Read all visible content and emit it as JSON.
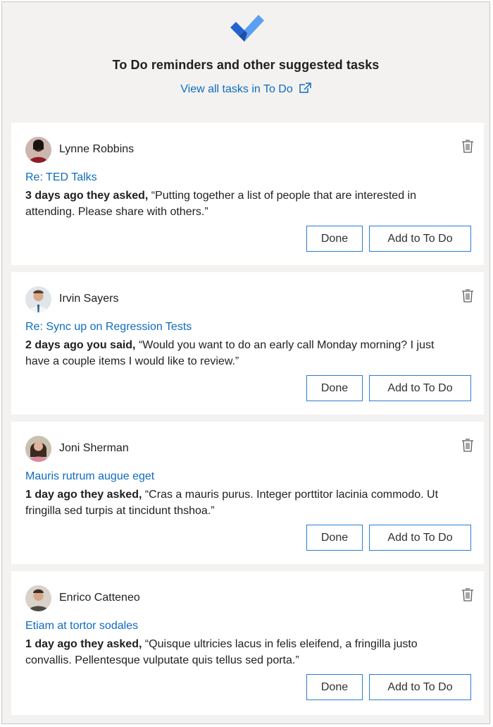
{
  "header": {
    "title": "To Do reminders and other suggested tasks",
    "view_all_label": "View all tasks in To Do",
    "logo_icon": "todo-checkmark-icon",
    "external_icon": "open-external-icon"
  },
  "colors": {
    "accent": "#0f6cbd",
    "button_border": "#2b7cd3",
    "panel_bg": "#f3f2f1",
    "logo_dark": "#2564cf",
    "logo_light": "#5aa0f2"
  },
  "cards": [
    {
      "name": "Lynne Robbins",
      "subject": "Re: TED Talks",
      "lead": "3 days ago they asked,",
      "quote": " “Putting together a list of people that are interested in attending. Please share with others.”",
      "done_label": "Done",
      "add_label": "Add to To Do",
      "avatar_bg": "#7a2b2b"
    },
    {
      "name": "Irvin Sayers",
      "subject": "Re: Sync up on Regression Tests",
      "lead": "2 days ago you said,",
      "quote": " “Would you want to do an early call Monday morning? I just have a couple items I would like to review.”",
      "done_label": "Done",
      "add_label": "Add to To Do",
      "avatar_bg": "#b8c9d6"
    },
    {
      "name": "Joni Sherman",
      "subject": "Mauris rutrum augue eget",
      "lead": "1 day ago they asked,",
      "quote": " “Cras a mauris purus. Integer porttitor lacinia commodo. Ut fringilla sed turpis at tincidunt thshoa.”",
      "done_label": "Done",
      "add_label": "Add to To Do",
      "avatar_bg": "#6b5a4a"
    },
    {
      "name": "Enrico Catteneo",
      "subject": "Etiam at tortor sodales",
      "lead": "1 day ago they asked,",
      "quote": " “Quisque ultricies lacus in felis eleifend, a fringilla justo convallis. Pellentesque vulputate quis tellus sed porta.”",
      "done_label": "Done",
      "add_label": "Add to To Do",
      "avatar_bg": "#8a7a6a"
    }
  ]
}
